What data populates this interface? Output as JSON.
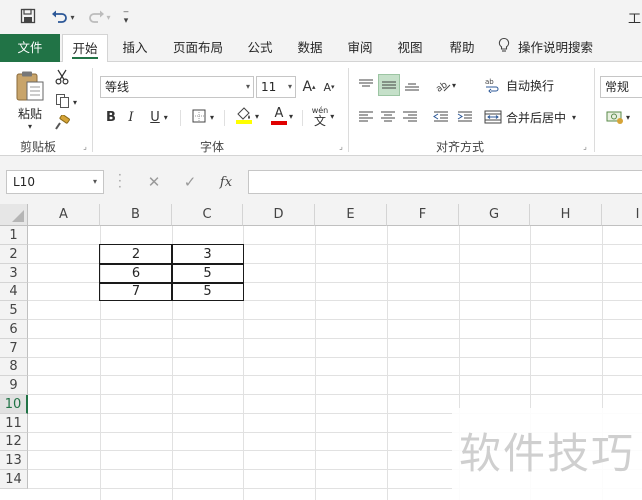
{
  "window": {
    "title_partial": "工"
  },
  "qat": {
    "save_icon": "save-icon",
    "undo_icon": "undo-icon",
    "redo_icon": "redo-icon",
    "customize_icon": "customize-qat-icon"
  },
  "tabs": [
    {
      "label": "文件"
    },
    {
      "label": "开始"
    },
    {
      "label": "插入"
    },
    {
      "label": "页面布局"
    },
    {
      "label": "公式"
    },
    {
      "label": "数据"
    },
    {
      "label": "审阅"
    },
    {
      "label": "视图"
    },
    {
      "label": "帮助"
    },
    {
      "label": "操作说明搜索"
    }
  ],
  "ribbon": {
    "clipboard": {
      "paste_label": "粘贴",
      "group_label": "剪贴板"
    },
    "font": {
      "font_name": "等线",
      "font_size": "11",
      "bold": "B",
      "italic": "I",
      "underline": "U",
      "font_color_glyph": "A",
      "phonetic_glyph": "wén",
      "phonetic_char": "文",
      "increase_glyph": "A",
      "decrease_glyph": "A",
      "group_label": "字体"
    },
    "alignment": {
      "wrap_text": "自动换行",
      "merge_center": "合并后居中",
      "group_label": "对齐方式"
    },
    "number": {
      "format": "常规"
    }
  },
  "formula_bar": {
    "name_box": "L10",
    "cancel_glyph": "✕",
    "enter_glyph": "✓",
    "fx_glyph": "fx",
    "value": ""
  },
  "sheet": {
    "columns": [
      "A",
      "B",
      "C",
      "D",
      "E",
      "F",
      "G",
      "H",
      "I"
    ],
    "rows": [
      "1",
      "2",
      "3",
      "4",
      "5",
      "6",
      "7",
      "8",
      "9",
      "10",
      "11",
      "12",
      "13",
      "14"
    ],
    "selected_row": "10",
    "table": [
      [
        "2",
        "3"
      ],
      [
        "6",
        "5"
      ],
      [
        "7",
        "5"
      ]
    ]
  },
  "watermark": "软件技巧"
}
